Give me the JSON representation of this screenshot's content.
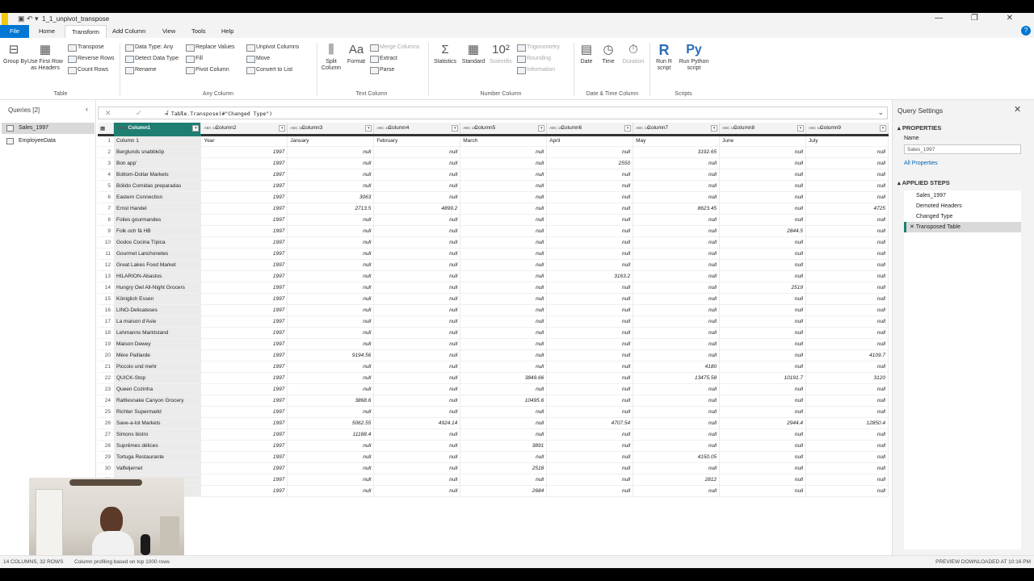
{
  "window": {
    "title": "1_1_unpivot_transpose",
    "quick_access": "▣ ↶ ▾",
    "controls": "— ❐ ✕"
  },
  "tabs": [
    "File",
    "Home",
    "Transform",
    "Add Column",
    "View",
    "Tools",
    "Help"
  ],
  "active_tab": "Transform",
  "ribbon": {
    "table_group": {
      "label": "Table",
      "group_by": "Group By",
      "use_first_row": "Use First Row as Headers",
      "transpose": "Transpose",
      "reverse_rows": "Reverse Rows",
      "count_rows": "Count Rows"
    },
    "any_column_group": {
      "label": "Any Column",
      "data_type": "Data Type: Any",
      "detect_data_type": "Detect Data Type",
      "rename": "Rename",
      "replace_values": "Replace Values",
      "fill": "Fill",
      "pivot_column": "Pivot Column",
      "unpivot_columns": "Unpivot Columns",
      "move": "Move",
      "convert_to_list": "Convert to List"
    },
    "text_column_group": {
      "label": "Text Column",
      "split_column": "Split Column",
      "format": "Format",
      "merge_columns": "Merge Columns",
      "extract": "Extract",
      "parse": "Parse"
    },
    "number_column_group": {
      "label": "Number Column",
      "statistics": "Statistics",
      "standard": "Standard",
      "scientific": "Scientific",
      "trigonometry": "Trigonometry",
      "rounding": "Rounding",
      "information": "Information"
    },
    "datetime_group": {
      "label": "Date & Time Column",
      "date": "Date",
      "time": "Time",
      "duration": "Duration"
    },
    "scripts_group": {
      "label": "Scripts",
      "run_r": "Run R script",
      "run_python": "Run Python script"
    }
  },
  "queries_pane": {
    "header": "Queries [2]",
    "collapse": "‹",
    "items": [
      "Sales_1997",
      "EmployeeData"
    ],
    "selected": "Sales_1997"
  },
  "formula_bar": {
    "icons": "✕ ✓ fx",
    "formula": "= Table.Transpose(#\"Changed Type\")",
    "expand": "⌄"
  },
  "columns": [
    "Column1",
    "Column2",
    "Column3",
    "Column4",
    "Column5",
    "Column6",
    "Column7",
    "Column8",
    "Column9"
  ],
  "column_type_label": "ABC 123",
  "rows": [
    [
      "Column 1",
      "Year",
      "January",
      "February",
      "March",
      "April",
      "May",
      "June",
      "July"
    ],
    [
      "Berglunds snabbköp",
      "1997",
      "null",
      "null",
      "null",
      "null",
      "3192.65",
      "null",
      "null"
    ],
    [
      "Bon app'",
      "1997",
      "null",
      "null",
      "null",
      "2550",
      "null",
      "null",
      "null"
    ],
    [
      "Bottom-Dollar Markets",
      "1997",
      "null",
      "null",
      "null",
      "null",
      "null",
      "null",
      "null"
    ],
    [
      "Bólido Comidas preparadas",
      "1997",
      "null",
      "null",
      "null",
      "null",
      "null",
      "null",
      "null"
    ],
    [
      "Eastern Connection",
      "1997",
      "3063",
      "null",
      "null",
      "null",
      "null",
      "null",
      "null"
    ],
    [
      "Ernst Handel",
      "1997",
      "2713.5",
      "4899.2",
      "null",
      "null",
      "8623.45",
      "null",
      "4725"
    ],
    [
      "Folies gourmandes",
      "1997",
      "null",
      "null",
      "null",
      "null",
      "null",
      "null",
      "null"
    ],
    [
      "Folk och fä HB",
      "1997",
      "null",
      "null",
      "null",
      "null",
      "null",
      "2844.5",
      "null"
    ],
    [
      "Godos Cocina Típica",
      "1997",
      "null",
      "null",
      "null",
      "null",
      "null",
      "null",
      "null"
    ],
    [
      "Gourmet Lanchonetes",
      "1997",
      "null",
      "null",
      "null",
      "null",
      "null",
      "null",
      "null"
    ],
    [
      "Great Lakes Food Market",
      "1997",
      "null",
      "null",
      "null",
      "null",
      "null",
      "null",
      "null"
    ],
    [
      "HILARION-Abastos",
      "1997",
      "null",
      "null",
      "null",
      "3163.2",
      "null",
      "null",
      "null"
    ],
    [
      "Hungry Owl All-Night Grocers",
      "1997",
      "null",
      "null",
      "null",
      "null",
      "null",
      "2519",
      "null"
    ],
    [
      "Königlich Essen",
      "1997",
      "null",
      "null",
      "null",
      "null",
      "null",
      "null",
      "null"
    ],
    [
      "LINO-Delicateses",
      "1997",
      "null",
      "null",
      "null",
      "null",
      "null",
      "null",
      "null"
    ],
    [
      "La maison d'Asie",
      "1997",
      "null",
      "null",
      "null",
      "null",
      "null",
      "null",
      "null"
    ],
    [
      "Lehmanns Marktstand",
      "1997",
      "null",
      "null",
      "null",
      "null",
      "null",
      "null",
      "null"
    ],
    [
      "Maison Dewey",
      "1997",
      "null",
      "null",
      "null",
      "null",
      "null",
      "null",
      "null"
    ],
    [
      "Mère Paillarde",
      "1997",
      "9194.56",
      "null",
      "null",
      "null",
      "null",
      "null",
      "4109.7"
    ],
    [
      "Piccolo und mehr",
      "1997",
      "null",
      "null",
      "null",
      "null",
      "4180",
      "null",
      "null"
    ],
    [
      "QUICK-Stop",
      "1997",
      "null",
      "null",
      "3849.66",
      "null",
      "13475.58",
      "10191.7",
      "3120"
    ],
    [
      "Queen Cozinha",
      "1997",
      "null",
      "null",
      "null",
      "null",
      "null",
      "null",
      "null"
    ],
    [
      "Rattlesnake Canyon Grocery",
      "1997",
      "3868.6",
      "null",
      "10495.6",
      "null",
      "null",
      "null",
      "null"
    ],
    [
      "Richter Supermarkt",
      "1997",
      "null",
      "null",
      "null",
      "null",
      "null",
      "null",
      "null"
    ],
    [
      "Save-a-lot Markets",
      "1997",
      "5062.55",
      "4924.14",
      "null",
      "4707.54",
      "null",
      "2944.4",
      "12850.4"
    ],
    [
      "Simons bistro",
      "1997",
      "11188.4",
      "null",
      "null",
      "null",
      "null",
      "null",
      "null"
    ],
    [
      "Suprêmes délices",
      "1997",
      "null",
      "null",
      "3891",
      "null",
      "null",
      "null",
      "null"
    ],
    [
      "Tortuga Restaurante",
      "1997",
      "null",
      "null",
      "null",
      "null",
      "4150.05",
      "null",
      "null"
    ],
    [
      "Vaffeljernet",
      "1997",
      "null",
      "null",
      "2518",
      "null",
      "null",
      "null",
      "null"
    ],
    [
      "",
      "1997",
      "null",
      "null",
      "null",
      "null",
      "2812",
      "null",
      "null"
    ],
    [
      "",
      "1997",
      "null",
      "null",
      "2684",
      "null",
      "null",
      "null",
      "null"
    ]
  ],
  "query_settings": {
    "title": "Query Settings",
    "close": "✕",
    "properties_header": "▴ PROPERTIES",
    "name_label": "Name",
    "name_value": "Sales_1997",
    "all_properties": "All Properties",
    "applied_steps_header": "▴ APPLIED STEPS",
    "steps": [
      "Sales_1997",
      "Demoted Headers",
      "Changed Type",
      "Transposed Table"
    ],
    "selected_step": "Transposed Table",
    "delete_icon": "✕"
  },
  "status": {
    "columns_rows": "14 COLUMNS, 32 ROWS",
    "profiling": "Column profiling based on top 1000 rows",
    "preview": "PREVIEW DOWNLOADED AT 10:16 PM"
  },
  "colors": {
    "accent": "#1f7e72",
    "file_tab": "#0078d4",
    "link": "#0063b1"
  }
}
